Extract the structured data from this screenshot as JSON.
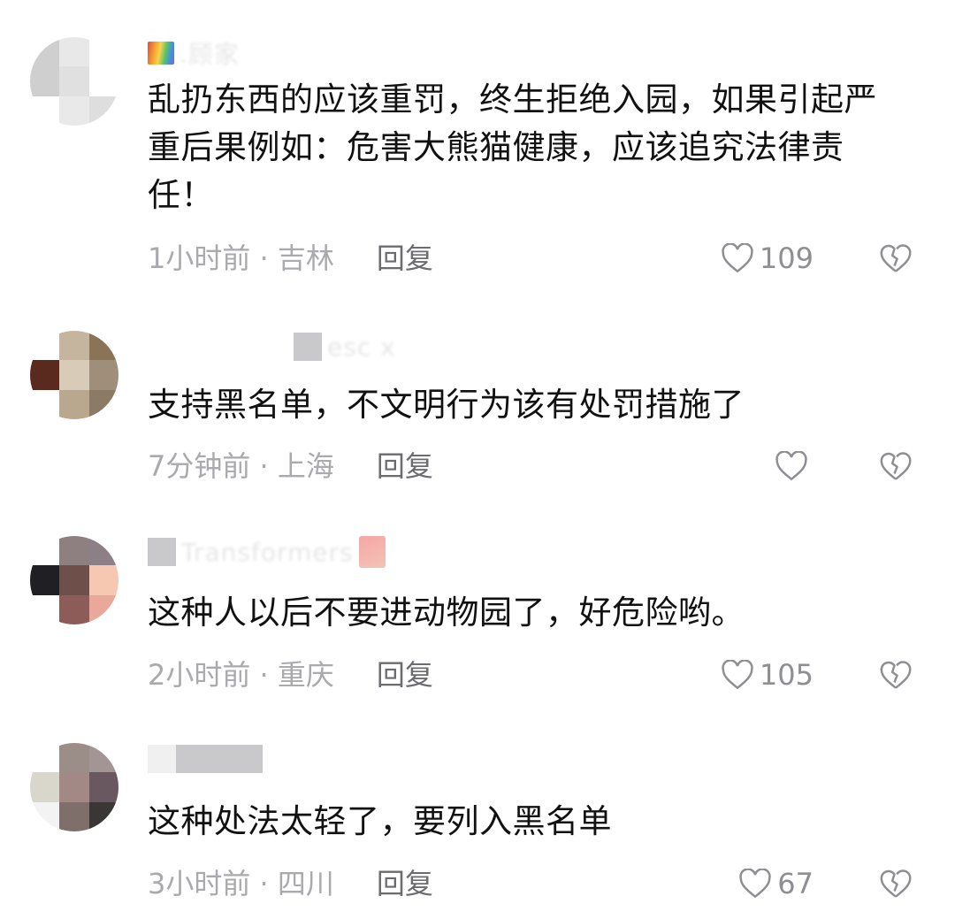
{
  "comments": [
    {
      "username_visible": ".顾家",
      "text": "乱扔东西的应该重罚，终生拒绝入园，如果引起严重后果例如：危害大熊猫健康，应该追究法律责任！",
      "time_location": "1小时前 · 吉林",
      "reply_label": "回复",
      "likes": "109",
      "avatar_colors": [
        "#cfcfcf",
        "#e8e8e8",
        "#ffffff",
        "#cfcfcf",
        "#e0e0e0",
        "#ffffff",
        "#ffffff",
        "#e9e9e9",
        "#dedede"
      ]
    },
    {
      "username_visible": "esc x",
      "text": "支持黑名单，不文明行为该有处罚措施了",
      "time_location": "7分钟前 · 上海",
      "reply_label": "回复",
      "likes": "",
      "avatar_colors": [
        "#ffffff",
        "#c6b59e",
        "#8a7356",
        "#5a2a1e",
        "#d8cbb7",
        "#9e8e7a",
        "#ffffff",
        "#b9a88e",
        "#8b7a66"
      ]
    },
    {
      "username_visible": "Transformers",
      "text": "这种人以后不要进动物园了，好危险哟。",
      "time_location": "2小时前 · 重庆",
      "reply_label": "回复",
      "likes": "105",
      "avatar_colors": [
        "#ffffff",
        "#8e7f80",
        "#8c7f86",
        "#1f1f24",
        "#6f4f4a",
        "#f6c8b2",
        "#ffffff",
        "#8d5c58",
        "#e9a89a"
      ]
    },
    {
      "username_visible": "",
      "text": "这种处法太轻了，要列入黑名单",
      "time_location": "3小时前 · 四川",
      "reply_label": "回复",
      "likes": "67",
      "avatar_colors": [
        "#ffffff",
        "#9b8d88",
        "#a39593",
        "#d9d7cc",
        "#a28986",
        "#6a5860",
        "#f3f3f3",
        "#7e6f6a",
        "#3a3636"
      ]
    }
  ],
  "icons": {
    "like": "heart-outline-icon",
    "dislike": "broken-heart-outline-icon"
  },
  "colors": {
    "text": "#111111",
    "meta": "#a9a9ae",
    "reply": "#6b6b70",
    "icon": "#8e8e93"
  }
}
